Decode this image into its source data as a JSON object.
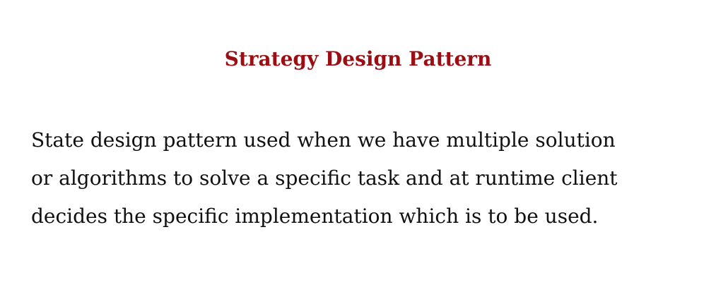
{
  "slide": {
    "title": "Strategy Design Pattern",
    "body_lines": [
      "State design pattern used when we have multiple solution",
      "or algorithms to solve a specific task and at runtime client",
      "decides the specific implementation which is to be used."
    ]
  },
  "colors": {
    "title": "#9b0f14",
    "text": "#111111",
    "background": "#ffffff"
  }
}
